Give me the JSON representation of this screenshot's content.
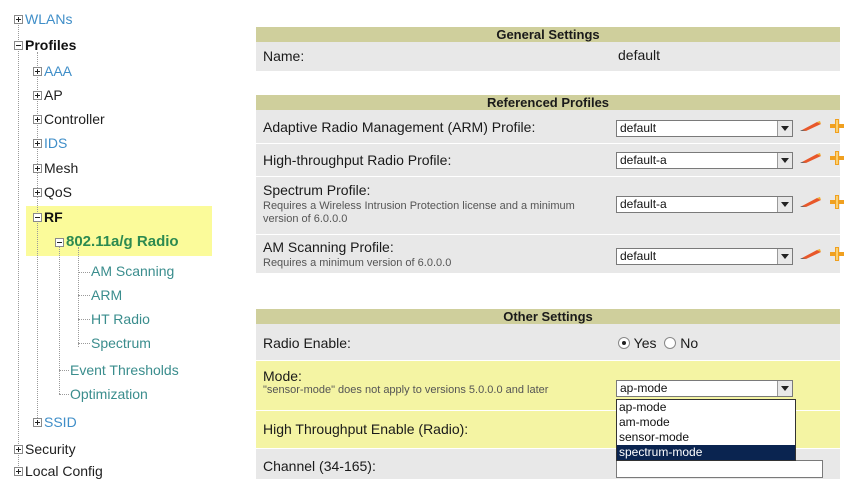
{
  "tree": {
    "wlans": "WLANs",
    "profiles": "Profiles",
    "aaa": "AAA",
    "ap": "AP",
    "controller": "Controller",
    "ids": "IDS",
    "mesh": "Mesh",
    "qos": "QoS",
    "rf": "RF",
    "radio": "802.11a/g Radio",
    "am_scanning": "AM Scanning",
    "arm": "ARM",
    "ht_radio": "HT Radio",
    "spectrum": "Spectrum",
    "event_thresholds": "Event Thresholds",
    "optimization": "Optimization",
    "ssid": "SSID",
    "security": "Security",
    "local_config": "Local Config"
  },
  "general": {
    "header": "General Settings",
    "name_label": "Name:",
    "name_value": "default"
  },
  "referenced": {
    "header": "Referenced Profiles",
    "arm_label": "Adaptive Radio Management (ARM) Profile:",
    "arm_value": "default",
    "ht_label": "High-throughput Radio Profile:",
    "ht_value": "default-a",
    "spectrum_label": "Spectrum Profile:",
    "spectrum_note": "Requires a Wireless Intrusion Protection license and a minimum version of 6.0.0.0",
    "spectrum_value": "default-a",
    "am_label": "AM Scanning Profile:",
    "am_note": "Requires a minimum version of 6.0.0.0",
    "am_value": "default"
  },
  "other": {
    "header": "Other Settings",
    "radio_enable_label": "Radio Enable:",
    "yes": "Yes",
    "no": "No",
    "mode_label": "Mode:",
    "mode_note": "\"sensor-mode\" does not apply to versions 5.0.0.0 and later",
    "mode_value": "ap-mode",
    "mode_options": [
      "ap-mode",
      "am-mode",
      "sensor-mode",
      "spectrum-mode"
    ],
    "ht_enable_label": "High Throughput Enable (Radio):",
    "channel_label": "Channel (34-165):"
  },
  "colors": {
    "highlight": "#fbfb9a",
    "header_bg": "#cfcf9c",
    "row_bg": "#e8e8e8",
    "link": "#3f8ec8",
    "selected_option": "#0a2450"
  },
  "icons": [
    "expand-icon",
    "collapse-icon",
    "pencil-edit-icon",
    "add-plus-icon",
    "dropdown-arrow-icon"
  ]
}
